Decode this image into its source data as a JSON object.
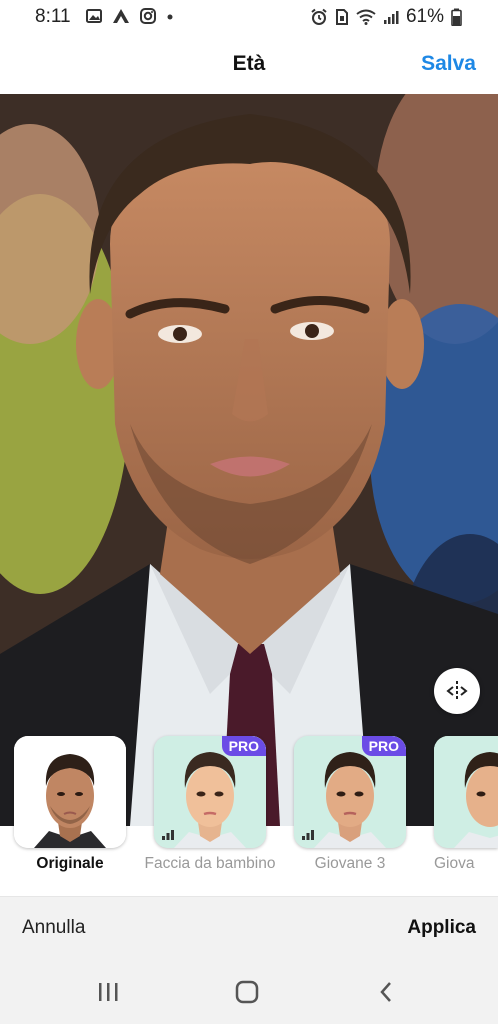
{
  "status_bar": {
    "time": "8:11",
    "battery": "61%",
    "left_icons": [
      "image-icon",
      "app-icon",
      "instagram-icon",
      "dot-icon"
    ],
    "right_icons": [
      "alarm-icon",
      "sim-icon",
      "wifi-icon",
      "signal-icon",
      "battery-icon"
    ]
  },
  "header": {
    "title": "Età",
    "save_label": "Salva"
  },
  "filters": [
    {
      "label": "Originale",
      "pro": false,
      "selected": true
    },
    {
      "label": "Faccia da bambino",
      "pro": true,
      "selected": false
    },
    {
      "label": "Giovane 3",
      "pro": true,
      "selected": false
    },
    {
      "label": "Giova",
      "pro": false,
      "selected": false
    }
  ],
  "pro_label": "PRO",
  "bottom_bar": {
    "cancel_label": "Annulla",
    "apply_label": "Applica"
  },
  "colors": {
    "accent": "#1e88e5",
    "pro_badge": "#6b4ce6"
  }
}
